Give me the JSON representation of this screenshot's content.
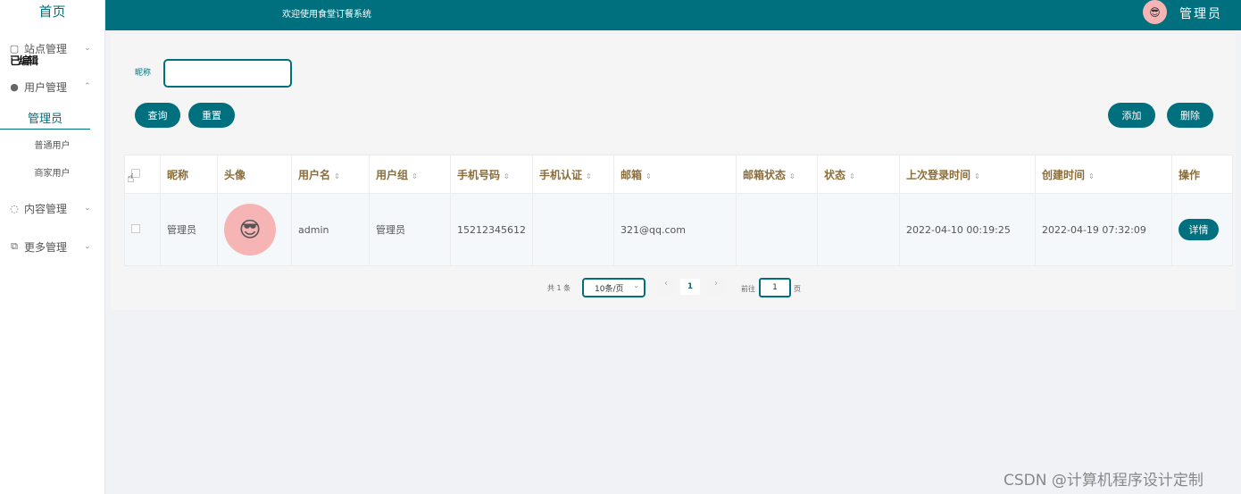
{
  "sidebar": {
    "home": "首页",
    "groups": [
      {
        "label": "站点管理",
        "icon": "monitor-icon",
        "glyph": "▢"
      },
      {
        "label": "用户管理",
        "icon": "user-icon",
        "glyph": "●",
        "ghost": "已编辑"
      },
      {
        "label": "内容管理",
        "icon": "chat-icon",
        "glyph": "◌"
      },
      {
        "label": "更多管理",
        "icon": "copy-icon",
        "glyph": "⧉"
      }
    ],
    "chevron_down": "⌄",
    "chevron_up": "⌃",
    "sub_items": [
      "管理员",
      "普通用户",
      "商家用户"
    ]
  },
  "header": {
    "welcome": "欢迎使用食堂订餐系统",
    "user": "管理员"
  },
  "search": {
    "nickname_label": "昵称",
    "nickname_value": "",
    "query_label": "查询",
    "reset_label": "重置",
    "add_label": "添加",
    "delete_label": "删除"
  },
  "table": {
    "headers": [
      "昵称",
      "头像",
      "用户名",
      "用户组",
      "手机号码",
      "手机认证",
      "邮箱",
      "邮箱状态",
      "状态",
      "上次登录时间",
      "创建时间",
      "操作"
    ],
    "rows": [
      {
        "nickname": "管理员",
        "username": "admin",
        "group": "管理员",
        "phone": "15212345612",
        "phone_verified": "",
        "email": "321@qq.com",
        "email_status": "",
        "status": "",
        "last_login": "2022-04-10 00:19:25",
        "created": "2022-04-19 07:32:09",
        "action": "详情"
      }
    ]
  },
  "pagination": {
    "total": "共 1 条",
    "page_size": "10条/页",
    "current_page": "1",
    "goto_label": "前往",
    "goto_value": "1",
    "page_suffix": "页"
  },
  "watermark": "CSDN @计算机程序设计定制",
  "colors": {
    "primary": "#00707f",
    "avatar_bg": "#f6b4b4"
  }
}
